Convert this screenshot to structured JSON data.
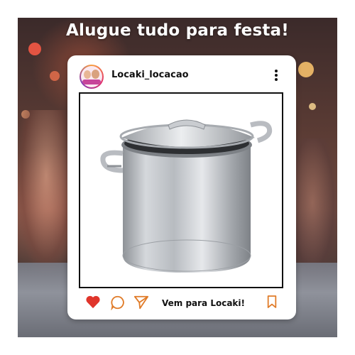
{
  "headline": "Alugue tudo para festa!",
  "post": {
    "username": "Locaki_locacao",
    "caption": "Vem para Locaki!",
    "product": "aluminum-stock-pot"
  },
  "icons": {
    "more": "more-vertical-icon",
    "like": "heart-icon",
    "comment": "comment-icon",
    "share": "send-icon",
    "save": "bookmark-icon"
  },
  "colors": {
    "heart": "#e0352b",
    "action_icons": "#e07b28",
    "text": "#111111",
    "card": "#ffffff"
  }
}
